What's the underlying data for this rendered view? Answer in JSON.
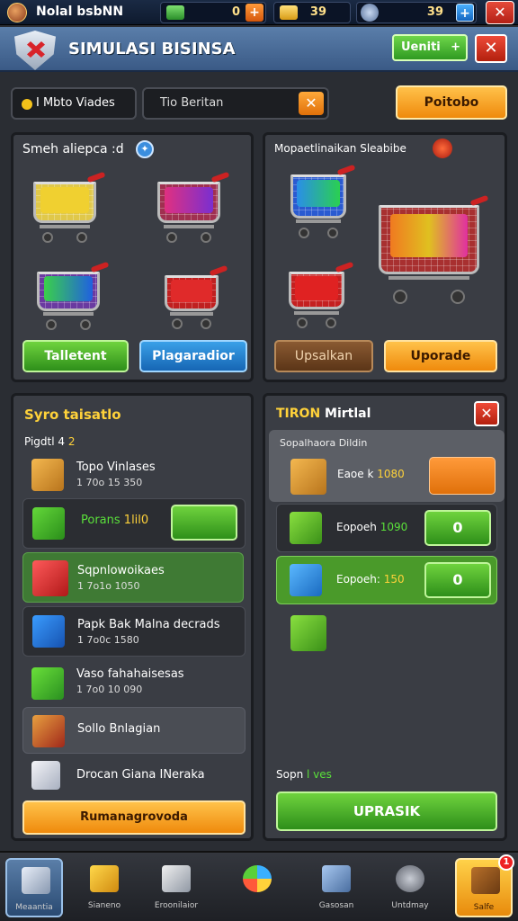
{
  "topbar": {
    "player_name": "Nolal bsbNN",
    "res1": {
      "value": "0"
    },
    "res2": {
      "value": "39"
    },
    "res3": {
      "value": "39"
    }
  },
  "header": {
    "title": "SIMULASI BISINSA",
    "green_button": "Ueniti",
    "close": "✕"
  },
  "filters": {
    "label": "I Mbto Viades",
    "search_value": "Tio Beritan",
    "clear": "✕",
    "orange_button": "Poitobo"
  },
  "panel_shop": {
    "title": "Smeh aliepca :d",
    "btn_green": "Talletent",
    "btn_blue": "Plagaradior"
  },
  "panel_upgrade": {
    "title": "Mopaetlinaikan Sleabibe",
    "btn_brown": "Upsalkan",
    "btn_orange": "Uporade"
  },
  "panel_list": {
    "title": "Syro taisatlo",
    "subtitle": "Pigdtl 4",
    "subtitle_accent": "2",
    "items": [
      {
        "name": "Topo Vinlases",
        "sub": "1 70o 15 350",
        "icon": "box-icon"
      },
      {
        "name": "Porans",
        "price": "1lil0",
        "icon": "green-box-icon"
      },
      {
        "name": "Sqpnlowoikaes",
        "sub": "1 7o1o 1050",
        "icon": "red-basket-icon"
      },
      {
        "name": "Papk Bak Malna decrads",
        "sub": "1 7o0c 1580",
        "icon": "blue-box-icon"
      },
      {
        "name": "Vaso fahahaisesas",
        "sub": "1 7o0 10 090",
        "icon": "green-bag-icon"
      },
      {
        "name": "Sollo Bnlagian",
        "sub": "",
        "icon": "red-box-icon"
      },
      {
        "name": "Drocan Giana INeraka",
        "sub": "",
        "icon": "white-box-icon"
      }
    ],
    "bottom_button": "Rumanagrovoda"
  },
  "panel_virtual": {
    "title_a": "TIRON",
    "title_b": "Mirtlal",
    "close": "✕",
    "section": "Sopalhaora Dildin",
    "rows": [
      {
        "label": "Eaoe k",
        "value": "1080",
        "btn": ""
      },
      {
        "label": "Eopoeh",
        "value": "1090",
        "btn": "0"
      },
      {
        "label": "Eopoeh:",
        "value": "150",
        "btn": "0"
      }
    ],
    "footer_label_a": "Sopn",
    "footer_label_b": "l ves",
    "button": "UPRASIK"
  },
  "nav": [
    {
      "label": "Meaantia",
      "icon": "cart-icon"
    },
    {
      "label": "Sianeno",
      "icon": "ticket-icon"
    },
    {
      "label": "Eroonilaior",
      "icon": "cube-icon"
    },
    {
      "label": "",
      "icon": "globe-icon"
    },
    {
      "label": "Gasosan",
      "icon": "factory-icon"
    },
    {
      "label": "Untdmay",
      "icon": "gears-icon"
    },
    {
      "label": "Salfe",
      "icon": "chest-icon",
      "badge": "1"
    }
  ]
}
